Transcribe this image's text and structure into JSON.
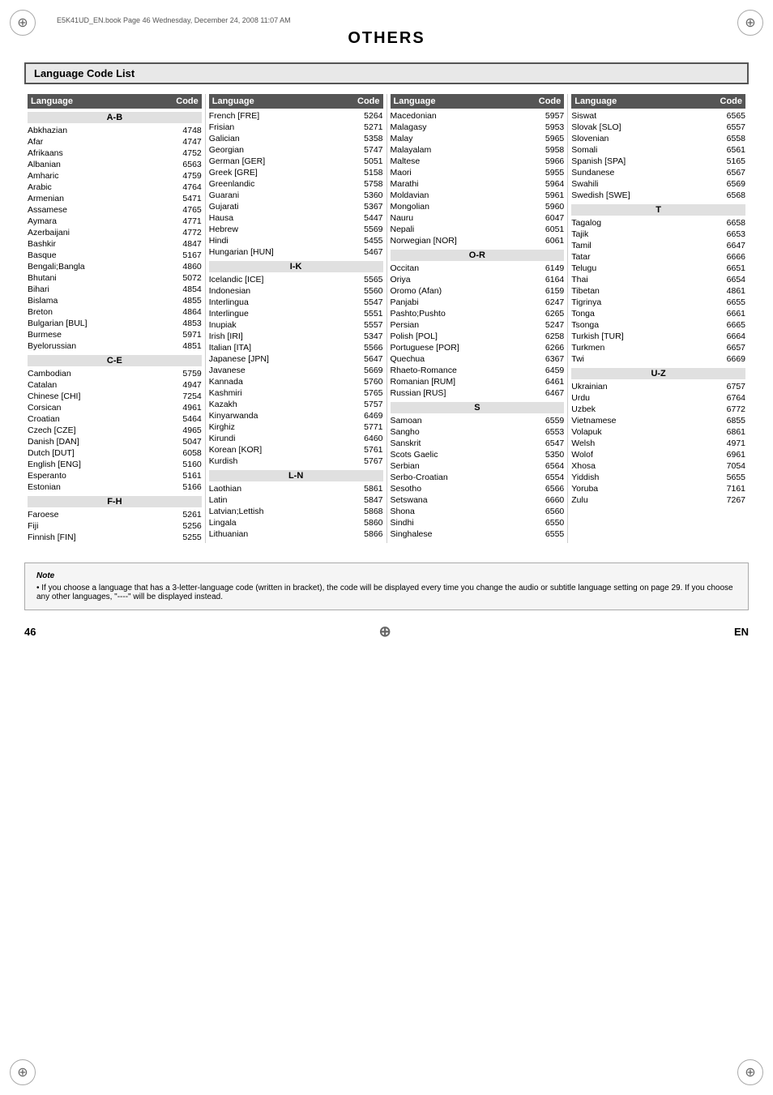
{
  "meta": {
    "filename": "E5K41UD_EN.book  Page 46  Wednesday, December 24, 2008  11:07 AM"
  },
  "title": "OTHERS",
  "section_title": "Language Code List",
  "columns": [
    {
      "header": {
        "lang": "Language",
        "code": "Code"
      },
      "sections": [
        {
          "label": "A-B",
          "rows": [
            {
              "lang": "Abkhazian",
              "code": "4748"
            },
            {
              "lang": "Afar",
              "code": "4747"
            },
            {
              "lang": "Afrikaans",
              "code": "4752"
            },
            {
              "lang": "Albanian",
              "code": "6563"
            },
            {
              "lang": "Amharic",
              "code": "4759"
            },
            {
              "lang": "Arabic",
              "code": "4764"
            },
            {
              "lang": "Armenian",
              "code": "5471"
            },
            {
              "lang": "Assamese",
              "code": "4765"
            },
            {
              "lang": "Aymara",
              "code": "4771"
            },
            {
              "lang": "Azerbaijani",
              "code": "4772"
            },
            {
              "lang": "Bashkir",
              "code": "4847"
            },
            {
              "lang": "Basque",
              "code": "5167"
            },
            {
              "lang": "Bengali;Bangla",
              "code": "4860"
            },
            {
              "lang": "Bhutani",
              "code": "5072"
            },
            {
              "lang": "Bihari",
              "code": "4854"
            },
            {
              "lang": "Bislama",
              "code": "4855"
            },
            {
              "lang": "Breton",
              "code": "4864"
            },
            {
              "lang": "Bulgarian [BUL]",
              "code": "4853"
            },
            {
              "lang": "Burmese",
              "code": "5971"
            },
            {
              "lang": "Byelorussian",
              "code": "4851"
            }
          ]
        },
        {
          "label": "C-E",
          "rows": [
            {
              "lang": "Cambodian",
              "code": "5759"
            },
            {
              "lang": "Catalan",
              "code": "4947"
            },
            {
              "lang": "Chinese [CHI]",
              "code": "7254"
            },
            {
              "lang": "Corsican",
              "code": "4961"
            },
            {
              "lang": "Croatian",
              "code": "5464"
            },
            {
              "lang": "Czech [CZE]",
              "code": "4965"
            },
            {
              "lang": "Danish [DAN]",
              "code": "5047"
            },
            {
              "lang": "Dutch [DUT]",
              "code": "6058"
            },
            {
              "lang": "English [ENG]",
              "code": "5160"
            },
            {
              "lang": "Esperanto",
              "code": "5161"
            },
            {
              "lang": "Estonian",
              "code": "5166"
            }
          ]
        },
        {
          "label": "F-H",
          "rows": [
            {
              "lang": "Faroese",
              "code": "5261"
            },
            {
              "lang": "Fiji",
              "code": "5256"
            },
            {
              "lang": "Finnish [FIN]",
              "code": "5255"
            }
          ]
        }
      ]
    },
    {
      "header": {
        "lang": "Language",
        "code": "Code"
      },
      "sections": [
        {
          "label": null,
          "rows": [
            {
              "lang": "French [FRE]",
              "code": "5264"
            },
            {
              "lang": "Frisian",
              "code": "5271"
            },
            {
              "lang": "Galician",
              "code": "5358"
            },
            {
              "lang": "Georgian",
              "code": "5747"
            },
            {
              "lang": "German [GER]",
              "code": "5051"
            },
            {
              "lang": "Greek [GRE]",
              "code": "5158"
            },
            {
              "lang": "Greenlandic",
              "code": "5758"
            },
            {
              "lang": "Guarani",
              "code": "5360"
            },
            {
              "lang": "Gujarati",
              "code": "5367"
            },
            {
              "lang": "Hausa",
              "code": "5447"
            },
            {
              "lang": "Hebrew",
              "code": "5569"
            },
            {
              "lang": "Hindi",
              "code": "5455"
            },
            {
              "lang": "Hungarian [HUN]",
              "code": "5467"
            }
          ]
        },
        {
          "label": "I-K",
          "rows": [
            {
              "lang": "Icelandic [ICE]",
              "code": "5565"
            },
            {
              "lang": "Indonesian",
              "code": "5560"
            },
            {
              "lang": "Interlingua",
              "code": "5547"
            },
            {
              "lang": "Interlingue",
              "code": "5551"
            },
            {
              "lang": "Inupiak",
              "code": "5557"
            },
            {
              "lang": "Irish [IRI]",
              "code": "5347"
            },
            {
              "lang": "Italian [ITA]",
              "code": "5566"
            },
            {
              "lang": "Japanese [JPN]",
              "code": "5647"
            },
            {
              "lang": "Javanese",
              "code": "5669"
            },
            {
              "lang": "Kannada",
              "code": "5760"
            },
            {
              "lang": "Kashmiri",
              "code": "5765"
            },
            {
              "lang": "Kazakh",
              "code": "5757"
            },
            {
              "lang": "Kinyarwanda",
              "code": "6469"
            },
            {
              "lang": "Kirghiz",
              "code": "5771"
            },
            {
              "lang": "Kirundi",
              "code": "6460"
            },
            {
              "lang": "Korean [KOR]",
              "code": "5761"
            },
            {
              "lang": "Kurdish",
              "code": "5767"
            }
          ]
        },
        {
          "label": "L-N",
          "rows": [
            {
              "lang": "Laothian",
              "code": "5861"
            },
            {
              "lang": "Latin",
              "code": "5847"
            },
            {
              "lang": "Latvian;Lettish",
              "code": "5868"
            },
            {
              "lang": "Lingala",
              "code": "5860"
            },
            {
              "lang": "Lithuanian",
              "code": "5866"
            }
          ]
        }
      ]
    },
    {
      "header": {
        "lang": "Language",
        "code": "Code"
      },
      "sections": [
        {
          "label": null,
          "rows": [
            {
              "lang": "Macedonian",
              "code": "5957"
            },
            {
              "lang": "Malagasy",
              "code": "5953"
            },
            {
              "lang": "Malay",
              "code": "5965"
            },
            {
              "lang": "Malayalam",
              "code": "5958"
            },
            {
              "lang": "Maltese",
              "code": "5966"
            },
            {
              "lang": "Maori",
              "code": "5955"
            },
            {
              "lang": "Marathi",
              "code": "5964"
            },
            {
              "lang": "Moldavian",
              "code": "5961"
            },
            {
              "lang": "Mongolian",
              "code": "5960"
            },
            {
              "lang": "Nauru",
              "code": "6047"
            },
            {
              "lang": "Nepali",
              "code": "6051"
            },
            {
              "lang": "Norwegian [NOR]",
              "code": "6061"
            }
          ]
        },
        {
          "label": "O-R",
          "rows": [
            {
              "lang": "Occitan",
              "code": "6149"
            },
            {
              "lang": "Oriya",
              "code": "6164"
            },
            {
              "lang": "Oromo (Afan)",
              "code": "6159"
            },
            {
              "lang": "Panjabi",
              "code": "6247"
            },
            {
              "lang": "Pashto;Pushto",
              "code": "6265"
            },
            {
              "lang": "Persian",
              "code": "5247"
            },
            {
              "lang": "Polish [POL]",
              "code": "6258"
            },
            {
              "lang": "Portuguese [POR]",
              "code": "6266"
            },
            {
              "lang": "Quechua",
              "code": "6367"
            },
            {
              "lang": "Rhaeto-Romance",
              "code": "6459"
            },
            {
              "lang": "Romanian [RUM]",
              "code": "6461"
            },
            {
              "lang": "Russian [RUS]",
              "code": "6467"
            }
          ]
        },
        {
          "label": "S",
          "rows": [
            {
              "lang": "Samoan",
              "code": "6559"
            },
            {
              "lang": "Sangho",
              "code": "6553"
            },
            {
              "lang": "Sanskrit",
              "code": "6547"
            },
            {
              "lang": "Scots Gaelic",
              "code": "5350"
            },
            {
              "lang": "Serbian",
              "code": "6564"
            },
            {
              "lang": "Serbo-Croatian",
              "code": "6554"
            },
            {
              "lang": "Sesotho",
              "code": "6566"
            },
            {
              "lang": "Setswana",
              "code": "6660"
            },
            {
              "lang": "Shona",
              "code": "6560"
            },
            {
              "lang": "Sindhi",
              "code": "6550"
            },
            {
              "lang": "Singhalese",
              "code": "6555"
            }
          ]
        }
      ]
    },
    {
      "header": {
        "lang": "Language",
        "code": "Code"
      },
      "sections": [
        {
          "label": null,
          "rows": [
            {
              "lang": "Siswat",
              "code": "6565"
            },
            {
              "lang": "Slovak [SLO]",
              "code": "6557"
            },
            {
              "lang": "Slovenian",
              "code": "6558"
            },
            {
              "lang": "Somali",
              "code": "6561"
            },
            {
              "lang": "Spanish [SPA]",
              "code": "5165"
            },
            {
              "lang": "Sundanese",
              "code": "6567"
            },
            {
              "lang": "Swahili",
              "code": "6569"
            },
            {
              "lang": "Swedish [SWE]",
              "code": "6568"
            }
          ]
        },
        {
          "label": "T",
          "rows": [
            {
              "lang": "Tagalog",
              "code": "6658"
            },
            {
              "lang": "Tajik",
              "code": "6653"
            },
            {
              "lang": "Tamil",
              "code": "6647"
            },
            {
              "lang": "Tatar",
              "code": "6666"
            },
            {
              "lang": "Telugu",
              "code": "6651"
            },
            {
              "lang": "Thai",
              "code": "6654"
            },
            {
              "lang": "Tibetan",
              "code": "4861"
            },
            {
              "lang": "Tigrinya",
              "code": "6655"
            },
            {
              "lang": "Tonga",
              "code": "6661"
            },
            {
              "lang": "Tsonga",
              "code": "6665"
            },
            {
              "lang": "Turkish [TUR]",
              "code": "6664"
            },
            {
              "lang": "Turkmen",
              "code": "6657"
            },
            {
              "lang": "Twi",
              "code": "6669"
            }
          ]
        },
        {
          "label": "U-Z",
          "rows": [
            {
              "lang": "Ukrainian",
              "code": "6757"
            },
            {
              "lang": "Urdu",
              "code": "6764"
            },
            {
              "lang": "Uzbek",
              "code": "6772"
            },
            {
              "lang": "Vietnamese",
              "code": "6855"
            },
            {
              "lang": "Volapuk",
              "code": "6861"
            },
            {
              "lang": "Welsh",
              "code": "4971"
            },
            {
              "lang": "Wolof",
              "code": "6961"
            },
            {
              "lang": "Xhosa",
              "code": "7054"
            },
            {
              "lang": "Yiddish",
              "code": "5655"
            },
            {
              "lang": "Yoruba",
              "code": "7161"
            },
            {
              "lang": "Zulu",
              "code": "7267"
            }
          ]
        }
      ]
    }
  ],
  "note": {
    "title": "Note",
    "text": "• If you choose a language that has a 3-letter-language code (written in bracket), the code will be displayed every time you change the audio or subtitle language setting on page 29. If you choose any other languages, \"----\" will be displayed instead."
  },
  "footer": {
    "page_number": "46",
    "lang": "EN"
  }
}
